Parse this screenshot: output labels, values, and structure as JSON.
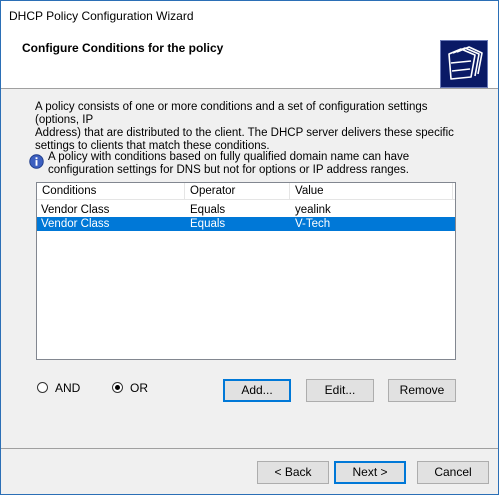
{
  "window": {
    "title": "DHCP Policy Configuration Wizard"
  },
  "header": {
    "heading": "Configure Conditions for the policy",
    "icon": "wizard-folders-icon"
  },
  "description": {
    "line1": "A policy consists of one or more conditions and a set of configuration settings (options, IP",
    "line2": "Address) that are distributed to the client. The DHCP server delivers these specific",
    "line3": "settings to clients that match these conditions."
  },
  "info": {
    "icon": "info-icon",
    "line1": "A policy with conditions based on fully qualified domain name can have",
    "line2": "configuration settings for DNS but not for options or IP address ranges."
  },
  "conditions_list": {
    "columns": [
      "Conditions",
      "Operator",
      "Value"
    ],
    "rows": [
      {
        "condition": "Vendor Class",
        "operator": "Equals",
        "value": "yealink",
        "selected": false
      },
      {
        "condition": "Vendor Class",
        "operator": "Equals",
        "value": "V-Tech",
        "selected": true
      }
    ]
  },
  "logic": {
    "and_label": "AND",
    "or_label": "OR",
    "selected": "OR"
  },
  "actions": {
    "add_label": "Add...",
    "edit_label": "Edit...",
    "remove_label": "Remove"
  },
  "footer": {
    "back_label": "< Back",
    "next_label": "Next >",
    "cancel_label": "Cancel"
  },
  "colors": {
    "selection": "#0078d7",
    "accent_border": "#0078d7",
    "window_border": "#2b6fb6"
  }
}
